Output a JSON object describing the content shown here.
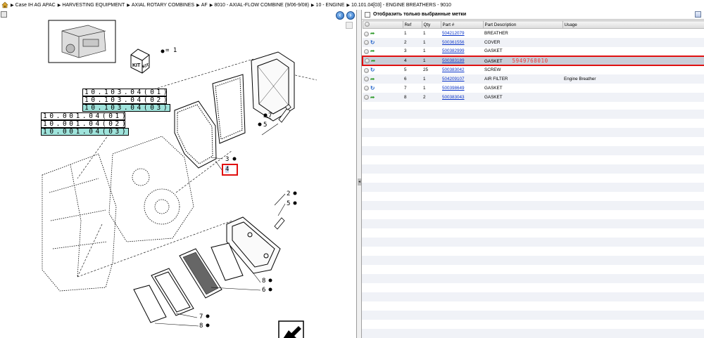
{
  "breadcrumb": {
    "items": [
      "Case IH AG APAC",
      "HARVESTING EQUIPMENT",
      "AXIAL ROTARY COMBINES",
      "AF",
      "8010 - AXIAL-FLOW COMBINE (9/06-9/08)",
      "10 - ENGINE",
      "10.101.04[03] - ENGINE BREATHERS - 9010"
    ]
  },
  "diagram": {
    "kit_legend": "= 1",
    "ref_boxes": [
      {
        "text": "10.103.04(01)",
        "highlight": false
      },
      {
        "text": "10.103.04(02)",
        "highlight": false
      },
      {
        "text": "10.103.04(03)",
        "highlight": true
      },
      {
        "text": "10.001.04(01)",
        "highlight": false
      },
      {
        "text": "10.001.04(02)",
        "highlight": false
      },
      {
        "text": "10.001.04(03)",
        "highlight": true
      }
    ],
    "callouts": {
      "c7": "7",
      "c5a": "5",
      "c3": "3",
      "c4": "4",
      "c2": "2",
      "c5b": "5",
      "c8a": "8",
      "c6": "6",
      "c7b": "7",
      "c8b": "8"
    }
  },
  "parts": {
    "filter_label": "Отобразить только выбранные метки",
    "columns": [
      "",
      "Ref",
      "Qty",
      "Part #",
      "Part Description",
      "Usage"
    ],
    "rows": [
      {
        "ref": "1",
        "qty": "1",
        "part": "504212079",
        "desc": "BREATHER",
        "usage": "",
        "icon": "green"
      },
      {
        "ref": "2",
        "qty": "1",
        "part": "500361556",
        "desc": "COVER",
        "usage": "",
        "icon": "blue"
      },
      {
        "ref": "3",
        "qty": "1",
        "part": "500382999",
        "desc": "GASKET",
        "usage": "",
        "icon": "green"
      },
      {
        "ref": "4",
        "qty": "1",
        "part": "500383189",
        "desc": "GASKET",
        "usage": "",
        "icon": "green",
        "overlay": "5949768010",
        "selected": true
      },
      {
        "ref": "5",
        "qty": "25",
        "part": "500383042",
        "desc": "SCREW",
        "usage": "",
        "icon": "blue"
      },
      {
        "ref": "6",
        "qty": "1",
        "part": "504209107",
        "desc": "AIR FILTER",
        "usage": "Engine Breather",
        "icon": "green"
      },
      {
        "ref": "7",
        "qty": "1",
        "part": "500398649",
        "desc": "GASKET",
        "usage": "",
        "icon": "blue"
      },
      {
        "ref": "8",
        "qty": "2",
        "part": "500383043",
        "desc": "GASKET",
        "usage": "",
        "icon": "green"
      }
    ]
  }
}
